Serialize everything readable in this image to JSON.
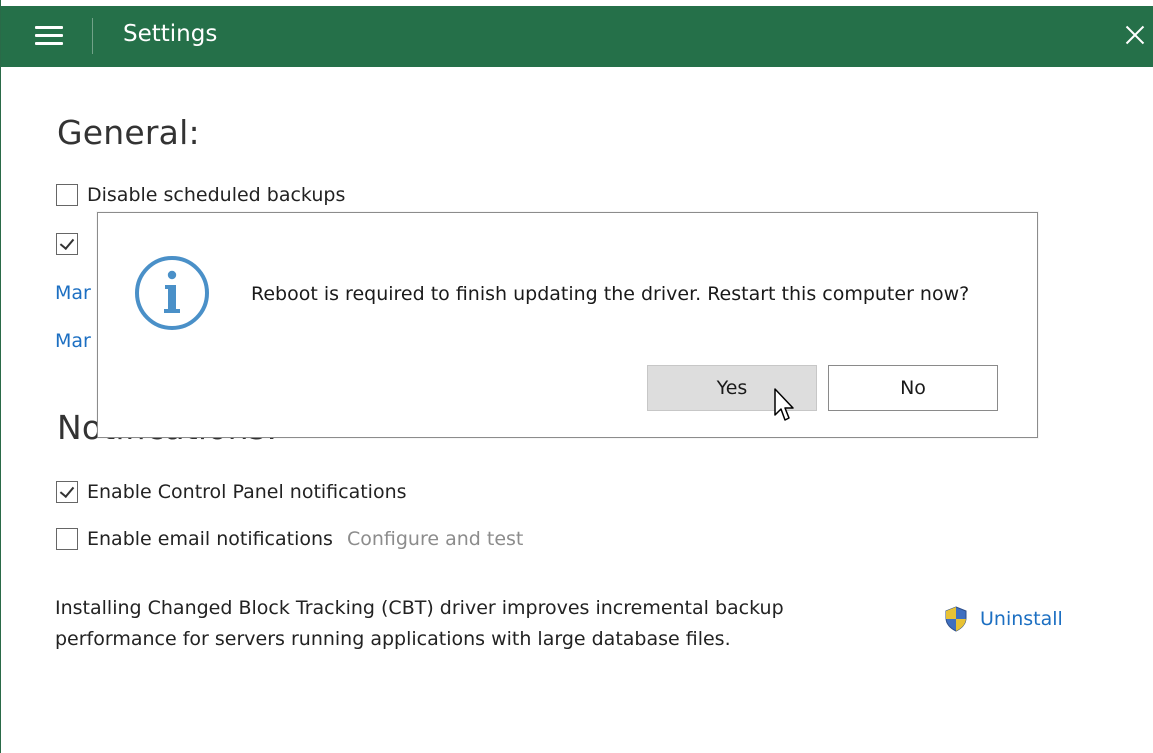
{
  "window": {
    "title": "Settings",
    "accent_color": "#257049",
    "menu_icon": "hamburger-icon",
    "close_icon": "close-icon"
  },
  "general": {
    "heading": "General:",
    "disable_scheduled_backups": {
      "label": "Disable scheduled backups",
      "checked": false
    },
    "second_option": {
      "checked": true
    }
  },
  "notifications": {
    "heading": "Notifications:",
    "control_panel": {
      "label": "Enable Control Panel notifications",
      "checked": true
    },
    "email": {
      "label": "Enable email notifications",
      "checked": false,
      "link": "Configure and test"
    }
  },
  "partial_links": {
    "link1": "Mar",
    "link2": "Mar"
  },
  "cbt": {
    "text_line1": "Installing Changed Block Tracking (CBT) driver improves incremental backup",
    "text_line2": "performance for servers running applications with large database files.",
    "uninstall_label": "Uninstall",
    "uninstall_icon": "shield-icon"
  },
  "dialog": {
    "icon": "info-icon",
    "message": "Reboot is required to finish updating the driver. Restart this computer now?",
    "yes_label": "Yes",
    "no_label": "No"
  },
  "colors": {
    "link": "#1c6fc2",
    "info_icon": "#4a90c8",
    "muted": "#8c8c8c"
  }
}
